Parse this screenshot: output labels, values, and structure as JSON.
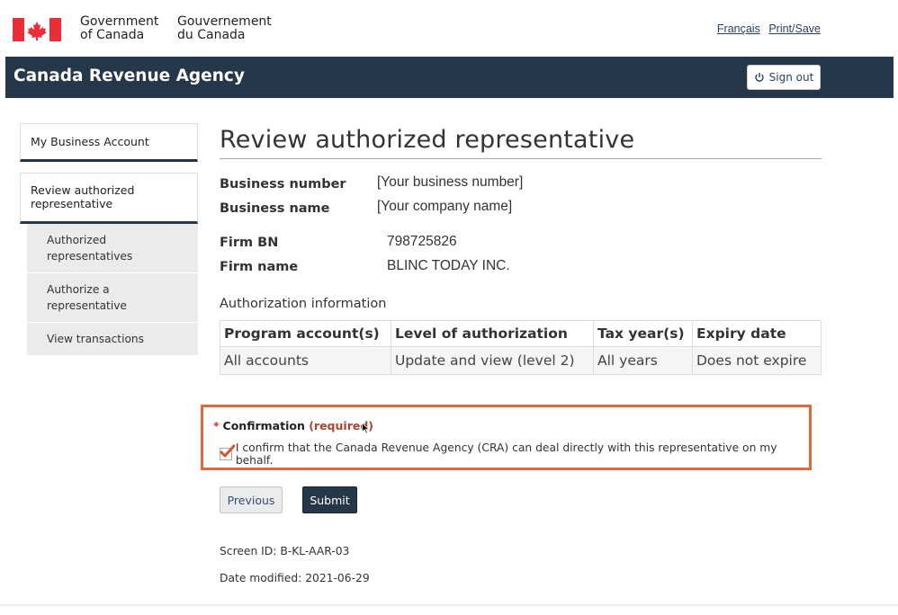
{
  "header": {
    "gov_en_line1": "Government",
    "gov_en_line2": "of Canada",
    "gov_fr_line1": "Gouvernement",
    "gov_fr_line2": "du Canada",
    "lang_link": "Français",
    "print_link": "Print/Save"
  },
  "banner": {
    "title": "Canada Revenue Agency",
    "signout_label": "Sign out"
  },
  "nav": {
    "home": "My Business Account",
    "section": "Review authorized representative",
    "items": [
      {
        "label": "Authorized representatives"
      },
      {
        "label": "Authorize a representative"
      },
      {
        "label": "View transactions"
      }
    ]
  },
  "main": {
    "title": "Review authorized representative",
    "business_number_label": "Business number",
    "business_number_value": "[Your business number]",
    "business_name_label": "Business name",
    "business_name_value": "[Your company name]",
    "firm_bn_label": "Firm BN",
    "firm_bn_value": "798725826",
    "firm_name_label": "Firm name",
    "firm_name_value": "BLINC TODAY INC.",
    "auth_info_label": "Authorization information",
    "table": {
      "headers": [
        "Program account(s)",
        "Level of authorization",
        "Tax year(s)",
        "Expiry date"
      ],
      "rows": [
        [
          "All accounts",
          "Update and view (level 2)",
          "All years",
          "Does not expire"
        ]
      ]
    }
  },
  "confirmation": {
    "star": "*",
    "label": "Confirmation",
    "required": "(required)",
    "checkbox_text": "I confirm that the Canada Revenue Agency (CRA) can deal directly with this representative on my behalf.",
    "checked": true
  },
  "buttons": {
    "previous": "Previous",
    "submit": "Submit"
  },
  "meta": {
    "screen_id": "Screen ID: B-KL-AAR-03",
    "date_modified": "Date modified: 2021-06-29"
  },
  "colors": {
    "banner": "#26374a",
    "highlight_border": "#de6a3a",
    "flag_red": "#eb2d37"
  }
}
